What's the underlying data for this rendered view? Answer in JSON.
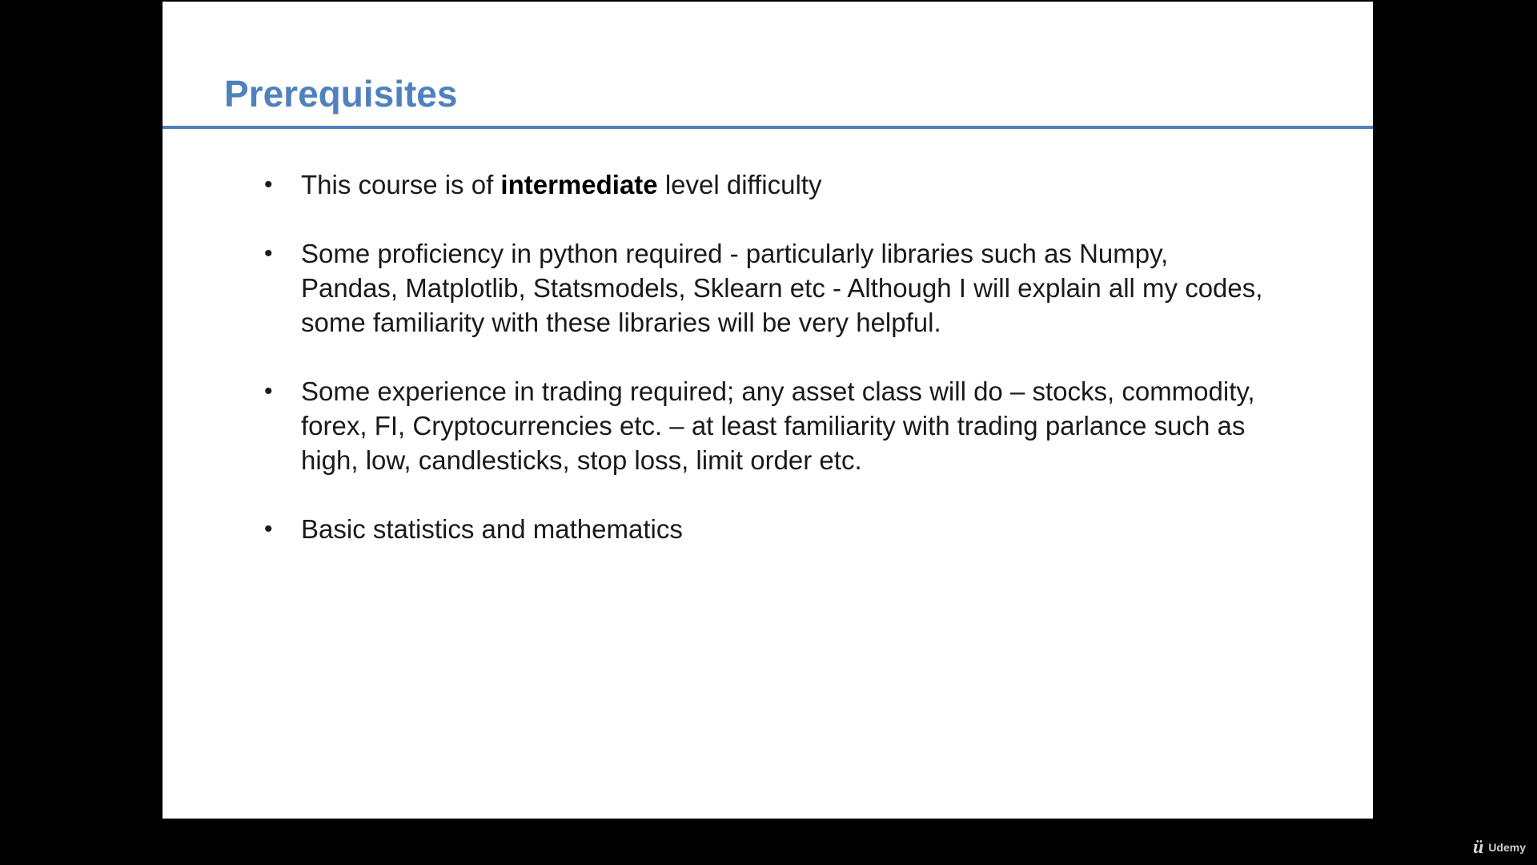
{
  "slide": {
    "title": "Prerequisites",
    "bullets": [
      {
        "pre": "This course is of ",
        "bold": "intermediate",
        "post": " level difficulty"
      },
      {
        "text": "Some proficiency in python required - particularly libraries such as Numpy, Pandas, Matplotlib, Statsmodels, Sklearn etc - Although I will explain all my codes, some familiarity with these libraries will be very helpful."
      },
      {
        "text": "Some experience in trading required; any asset class will do – stocks, commodity, forex, FI, Cryptocurrencies etc. – at least familiarity with trading parlance such as high, low, candlesticks, stop loss, limit order etc."
      },
      {
        "text": "Basic statistics and mathematics"
      }
    ],
    "bullet_glyph": "•"
  },
  "watermark": {
    "brand": "Udemy",
    "icon": "udemy-logo-icon"
  },
  "colors": {
    "accent": "#4f81bd",
    "background": "#000000",
    "slide": "#ffffff"
  }
}
